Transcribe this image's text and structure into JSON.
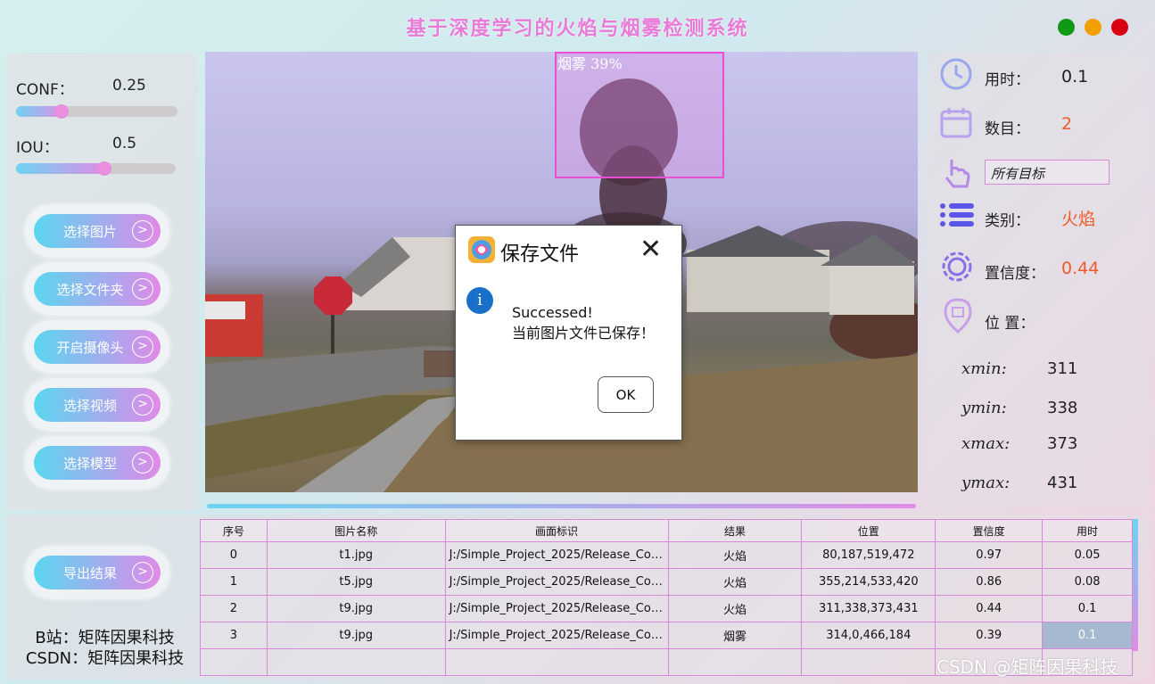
{
  "window": {
    "title": "基于深度学习的火焰与烟雾检测系统",
    "colors": {
      "close": "#d90012",
      "minimize": "#f0a000",
      "maximize": "#0f9a16"
    }
  },
  "params": {
    "conf_label": "CONF：",
    "conf_value": "0.25",
    "conf_fraction": 0.25,
    "iou_label": "IOU：",
    "iou_value": "0.5",
    "iou_fraction": 0.5
  },
  "buttons": {
    "select_image": "选择图片",
    "select_folder": "选择文件夹",
    "open_camera": "开启摄像头",
    "select_video": "选择视频",
    "select_model": "选择模型",
    "export": "导出结果"
  },
  "detection": {
    "label": "烟雾 39%"
  },
  "dialog": {
    "title": "保存文件",
    "message_line1": "Successed!",
    "message_line2": "当前图片文件已保存！",
    "ok_label": "OK",
    "close_glyph": "✕",
    "info_glyph": "i"
  },
  "stats": {
    "time_label": "用时：",
    "time_value": "0.1",
    "count_label": "数目：",
    "count_value": "2",
    "target_select": "所有目标",
    "class_label": "类别：",
    "class_value": "火焰",
    "conf_label": "置信度：",
    "conf_value": "0.44",
    "position_label": "位 置：",
    "xmin_label": "xmin:",
    "xmin_value": "311",
    "ymin_label": "ymin:",
    "ymin_value": "338",
    "xmax_label": "xmax:",
    "xmax_value": "373",
    "ymax_label": "ymax:",
    "ymax_value": "431",
    "accent_color": "#f0592a"
  },
  "table": {
    "headers": [
      "序号",
      "图片名称",
      "画面标识",
      "结果",
      "位置",
      "置信度",
      "用时"
    ],
    "rows": [
      [
        "0",
        "t1.jpg",
        "J:/Simple_Project_2025/Release_Code...",
        "火焰",
        "80,187,519,472",
        "0.97",
        "0.05"
      ],
      [
        "1",
        "t5.jpg",
        "J:/Simple_Project_2025/Release_Code...",
        "火焰",
        "355,214,533,420",
        "0.86",
        "0.08"
      ],
      [
        "2",
        "t9.jpg",
        "J:/Simple_Project_2025/Release_Code...",
        "火焰",
        "311,338,373,431",
        "0.44",
        "0.1"
      ],
      [
        "3",
        "t9.jpg",
        "J:/Simple_Project_2025/Release_Code...",
        "烟雾",
        "314,0,466,184",
        "0.39",
        "0.1"
      ],
      [
        "",
        "",
        "",
        "",
        "",
        "",
        ""
      ]
    ]
  },
  "credits": {
    "bilibili": "B站：矩阵因果科技",
    "csdn": "CSDN：矩阵因果科技",
    "watermark": "CSDN @矩阵因果科技"
  }
}
